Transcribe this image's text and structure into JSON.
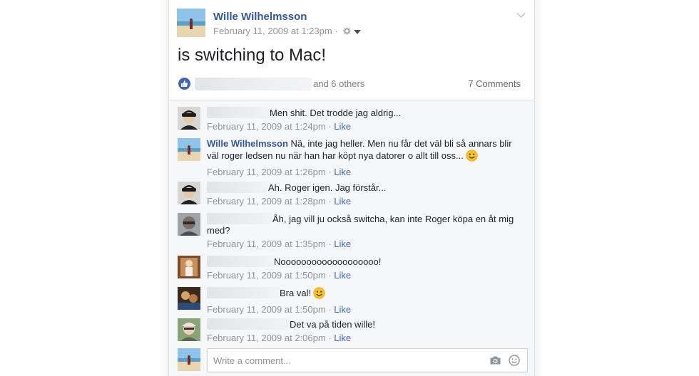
{
  "post": {
    "author": "Wille Wilhelmsson",
    "timestamp": "February 11, 2009 at 1:23pm",
    "privacy_icon": "gear-icon",
    "status": "is switching to Mac!",
    "reactions": {
      "others_text": "and 6 others",
      "comments_count": "7 Comments"
    }
  },
  "comments": [
    {
      "name": "",
      "text": "Men shit. Det trodde jag aldrig...",
      "time": "February 11, 2009 at 1:24pm",
      "like": "Like"
    },
    {
      "name": "Wille Wilhelmsson",
      "text": "Nä, inte jag heller. Men nu får det väl bli så annars blir väl roger ledsen nu när han har köpt nya datorer o allt till oss...",
      "time": "February 11, 2009 at 1:26pm",
      "like": "Like"
    },
    {
      "name": "",
      "text": "Ah. Roger igen. Jag förstår...",
      "time": "February 11, 2009 at 1:28pm",
      "like": "Like"
    },
    {
      "name": "",
      "text": "Åh, jag vill ju också switcha, kan inte Roger köpa en åt mig med?",
      "time": "February 11, 2009 at 1:35pm",
      "like": "Like"
    },
    {
      "name": "",
      "text": "Nooooooooooooooooooo!",
      "time": "February 11, 2009 at 1:50pm",
      "like": "Like"
    },
    {
      "name": "",
      "text": "Bra val!",
      "time": "February 11, 2009 at 1:50pm",
      "like": "Like"
    },
    {
      "name": "",
      "text": "Det va på tiden wille!",
      "time": "February 11, 2009 at 2:06pm",
      "like": "Like"
    }
  ],
  "composer": {
    "placeholder": "Write a comment..."
  },
  "separator": " · ",
  "colors": {
    "link": "#365899",
    "like_blue": "#4267b2",
    "meta_gray": "#90949c",
    "comments_bg": "#f6f7f9",
    "smiley": "#f7c325"
  }
}
